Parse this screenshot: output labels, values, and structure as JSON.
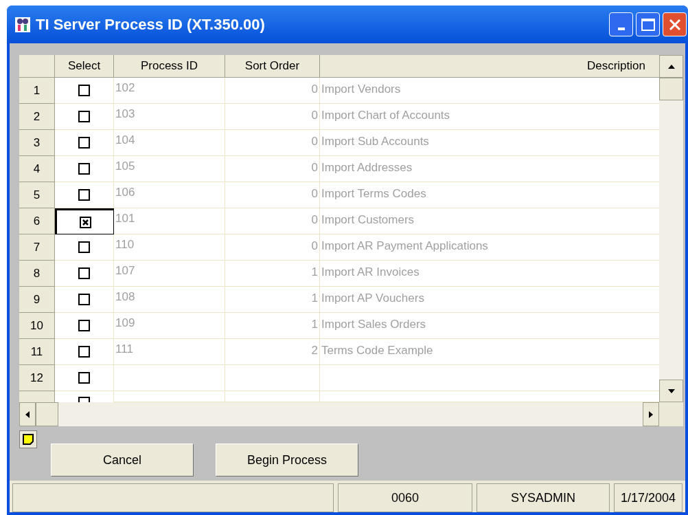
{
  "window": {
    "title": "TI Server Process ID (XT.350.00)"
  },
  "table": {
    "columns": [
      "Select",
      "Process ID",
      "Sort Order",
      "Description"
    ],
    "rows": [
      {
        "number": "1",
        "checked": false,
        "focused": false,
        "process_id": "102",
        "sort_order": "0",
        "description": "Import Vendors"
      },
      {
        "number": "2",
        "checked": false,
        "focused": false,
        "process_id": "103",
        "sort_order": "0",
        "description": "Import Chart of Accounts"
      },
      {
        "number": "3",
        "checked": false,
        "focused": false,
        "process_id": "104",
        "sort_order": "0",
        "description": "Import Sub Accounts"
      },
      {
        "number": "4",
        "checked": false,
        "focused": false,
        "process_id": "105",
        "sort_order": "0",
        "description": "Import Addresses"
      },
      {
        "number": "5",
        "checked": false,
        "focused": false,
        "process_id": "106",
        "sort_order": "0",
        "description": "Import Terms Codes"
      },
      {
        "number": "6",
        "checked": true,
        "focused": true,
        "process_id": "101",
        "sort_order": "0",
        "description": "Import Customers"
      },
      {
        "number": "7",
        "checked": false,
        "focused": false,
        "process_id": "110",
        "sort_order": "0",
        "description": "Import AR Payment Applications"
      },
      {
        "number": "8",
        "checked": false,
        "focused": false,
        "process_id": "107",
        "sort_order": "1",
        "description": "Import AR Invoices"
      },
      {
        "number": "9",
        "checked": false,
        "focused": false,
        "process_id": "108",
        "sort_order": "1",
        "description": "Import AP Vouchers"
      },
      {
        "number": "10",
        "checked": false,
        "focused": false,
        "process_id": "109",
        "sort_order": "1",
        "description": "Import Sales Orders"
      },
      {
        "number": "11",
        "checked": false,
        "focused": false,
        "process_id": "111",
        "sort_order": "2",
        "description": "Terms Code Example"
      },
      {
        "number": "12",
        "checked": false,
        "focused": false
      },
      {
        "checked": false,
        "focused": false
      }
    ]
  },
  "buttons": [
    "Cancel",
    "Begin Process"
  ],
  "status_bar": [
    "0060",
    "SYSADMIN",
    "1/17/2004"
  ]
}
